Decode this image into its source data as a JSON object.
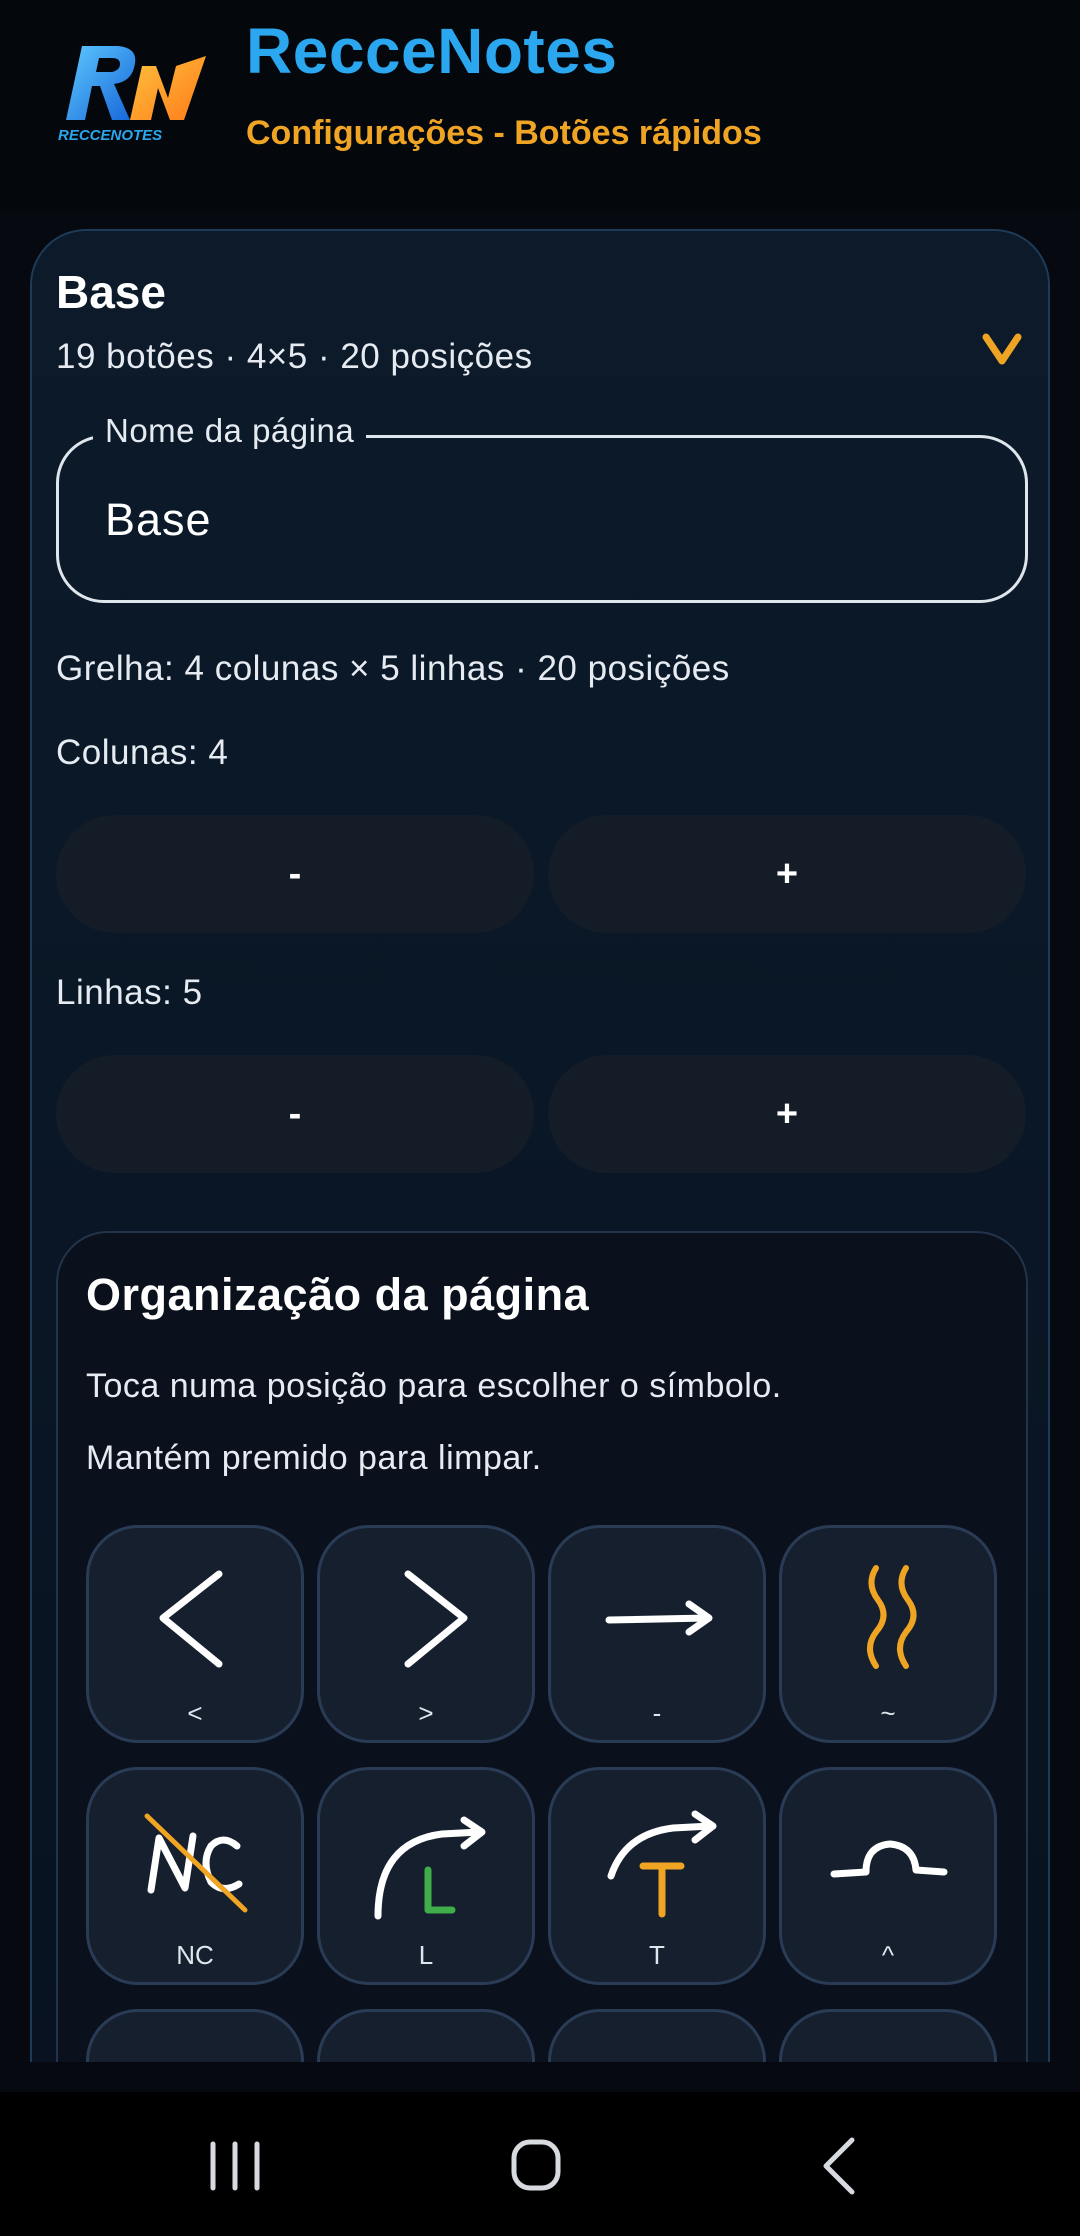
{
  "app": {
    "title": "RecceNotes",
    "subtitle": "Configurações - Botões rápidos",
    "logo_text": "RECCENOTES",
    "logo_icon": "rn-logo"
  },
  "page": {
    "name": "Base",
    "summary": "19 botões · 4×5 · 20 posições",
    "collapse_icon": "chevron-down-icon",
    "name_field_label": "Nome da página",
    "name_field_value": "Base",
    "grid_info": "Grelha: 4 colunas × 5 linhas · 20 posições",
    "columns_label": "Colunas: 4",
    "rows_label": "Linhas: 5",
    "decrement_label": "-",
    "increment_label": "+"
  },
  "organization": {
    "title": "Organização da página",
    "help_line1": "Toca numa posição para escolher o símbolo.",
    "help_line2": "Mantém premido para limpar.",
    "slots": [
      {
        "label": "<",
        "icon": "left-bend-icon"
      },
      {
        "label": ">",
        "icon": "right-bend-icon"
      },
      {
        "label": "-",
        "icon": "straight-arrow-icon"
      },
      {
        "label": "~",
        "icon": "wavy-road-icon"
      },
      {
        "label": "NC",
        "icon": "no-cut-icon"
      },
      {
        "label": "L",
        "icon": "long-turn-icon"
      },
      {
        "label": "T",
        "icon": "tight-turn-icon"
      },
      {
        "label": "^",
        "icon": "crest-icon"
      },
      {
        "label": "",
        "icon": "jump-icon"
      },
      {
        "label": "",
        "icon": "caution-jump-icon"
      },
      {
        "label": "",
        "icon": "narrow-icon"
      },
      {
        "label": "",
        "icon": "roundabout-icon"
      }
    ]
  },
  "navbar": {
    "recents_icon": "recent-apps-icon",
    "home_icon": "home-icon",
    "back_icon": "back-icon"
  },
  "colors": {
    "brand_blue": "#2aa7ee",
    "accent_orange": "#f0a424",
    "background": "#060a10",
    "card_border": "#1d3a57",
    "slot_bg": "#151f2e",
    "green_letter": "#3fae4a",
    "red_mark": "#e0342c"
  }
}
